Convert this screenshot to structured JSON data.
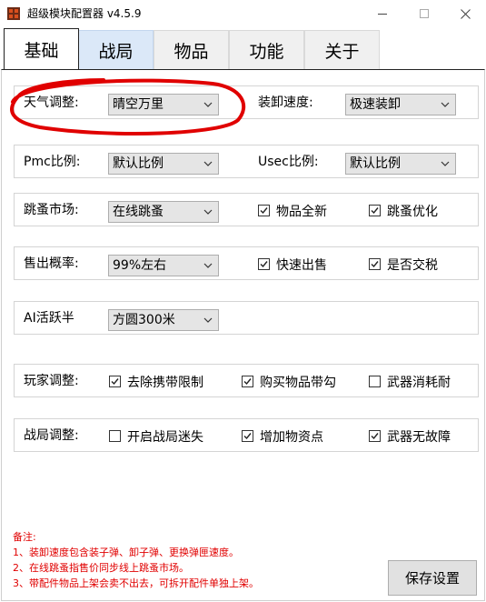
{
  "window": {
    "title": "超级模块配置器 v4.5.9",
    "icon": "app-logo-icon"
  },
  "tabs": [
    "基础",
    "战局",
    "物品",
    "功能",
    "关于"
  ],
  "active_tab": "基础",
  "rows": {
    "weather": {
      "label": "天气调整:",
      "value": "晴空万里"
    },
    "reload": {
      "label": "装卸速度:",
      "value": "极速装卸"
    },
    "pmc": {
      "label": "Pmc比例:",
      "value": "默认比例"
    },
    "usec": {
      "label": "Usec比例:",
      "value": "默认比例"
    },
    "flea": {
      "label": "跳蚤市场:",
      "value": "在线跳蚤",
      "checks": [
        {
          "label": "物品全新",
          "checked": true
        },
        {
          "label": "跳蚤优化",
          "checked": true
        }
      ]
    },
    "sell": {
      "label": "售出概率:",
      "value": "99%左右",
      "checks": [
        {
          "label": "快速出售",
          "checked": true
        },
        {
          "label": "是否交税",
          "checked": true
        }
      ]
    },
    "ai": {
      "label": "AI活跃半",
      "value": "方圆300米"
    },
    "player": {
      "label": "玩家调整:",
      "checks": [
        {
          "label": "去除携带限制",
          "checked": true
        },
        {
          "label": "购买物品带勾",
          "checked": true
        },
        {
          "label": "武器消耗耐",
          "checked": false
        }
      ]
    },
    "raid": {
      "label": "战局调整:",
      "checks": [
        {
          "label": "开启战局迷失",
          "checked": false
        },
        {
          "label": "增加物资点",
          "checked": true
        },
        {
          "label": "武器无故障",
          "checked": true
        }
      ]
    }
  },
  "notes": {
    "title": "备注:",
    "lines": [
      "1、装卸速度包含装子弹、卸子弹、更换弹匣速度。",
      "2、在线跳蚤指售价同步线上跳蚤市场。",
      "3、带配件物品上架会卖不出去，可拆开配件单独上架。"
    ]
  },
  "save_button": "保存设置",
  "colors": {
    "accent": "#dbe8f8",
    "notes": "#e00000",
    "annotation": "#e00000"
  }
}
